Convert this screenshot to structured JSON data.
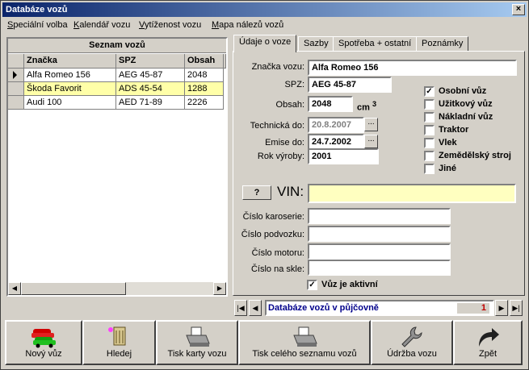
{
  "window": {
    "title": "Databáze vozů",
    "close_glyph": "×"
  },
  "menu": [
    "Speciální volba",
    "Kalendář vozu",
    "Vytíženost vozu",
    "Mapa nálezů vozů"
  ],
  "list": {
    "title": "Seznam vozů",
    "columns": [
      "Značka",
      "SPZ",
      "Obsah"
    ],
    "rows": [
      {
        "brand": "Alfa Romeo 156",
        "spz": "AEG 45-87",
        "volume": "2048"
      },
      {
        "brand": "Škoda Favorit",
        "spz": "ADS 45-54",
        "volume": "1288"
      },
      {
        "brand": "Audi 100",
        "spz": "AED 71-89",
        "volume": "2226"
      }
    ]
  },
  "tabs": [
    "Údaje o voze",
    "Sazby",
    "Spotřeba + ostatní",
    "Poznámky"
  ],
  "form": {
    "brand_label": "Značka vozu:",
    "brand_value": "Alfa Romeo 156",
    "spz_label": "SPZ:",
    "spz_value": "AEG 45-87",
    "volume_label": "Obsah:",
    "volume_value": "2048",
    "volume_unit": "cm",
    "volume_sup": "3",
    "tech_label": "Technická do:",
    "tech_value": "20.8.2007",
    "emise_label": "Emise do:",
    "emise_value": "24.7.2002",
    "year_label": "Rok výroby:",
    "year_value": "2001",
    "vin_button": "?",
    "vin_label": "VIN:",
    "vin_value": "",
    "body_label": "Číslo karoserie:",
    "body_value": "",
    "chassis_label": "Číslo podvozku:",
    "chassis_value": "",
    "engine_label": "Číslo motoru:",
    "engine_value": "",
    "glass_label": "Číslo na skle:",
    "glass_value": "",
    "active_label": "Vůz je aktivní",
    "active_checked": true,
    "dots": "..."
  },
  "vehicle_types": [
    {
      "label": "Osobní vůz",
      "checked": true
    },
    {
      "label": "Užitkový vůz",
      "checked": false
    },
    {
      "label": "Nákladní vůz",
      "checked": false
    },
    {
      "label": "Traktor",
      "checked": false
    },
    {
      "label": "Vlek",
      "checked": false
    },
    {
      "label": "Zemědělský stroj",
      "checked": false
    },
    {
      "label": "Jiné",
      "checked": false
    }
  ],
  "navigator": {
    "text": "Databáze vozů v půjčovně",
    "count": "1"
  },
  "toolbar": [
    {
      "label": "Nový vůz",
      "icon": "cars-icon"
    },
    {
      "label": "Hledej",
      "icon": "search-files-icon"
    },
    {
      "label": "Tisk karty vozu",
      "icon": "printer-icon"
    },
    {
      "label": "Tisk celého seznamu vozů",
      "icon": "printer-icon"
    },
    {
      "label": "Údržba vozu",
      "icon": "wrench-icon"
    },
    {
      "label": "Zpět",
      "icon": "back-arrow-icon"
    }
  ]
}
